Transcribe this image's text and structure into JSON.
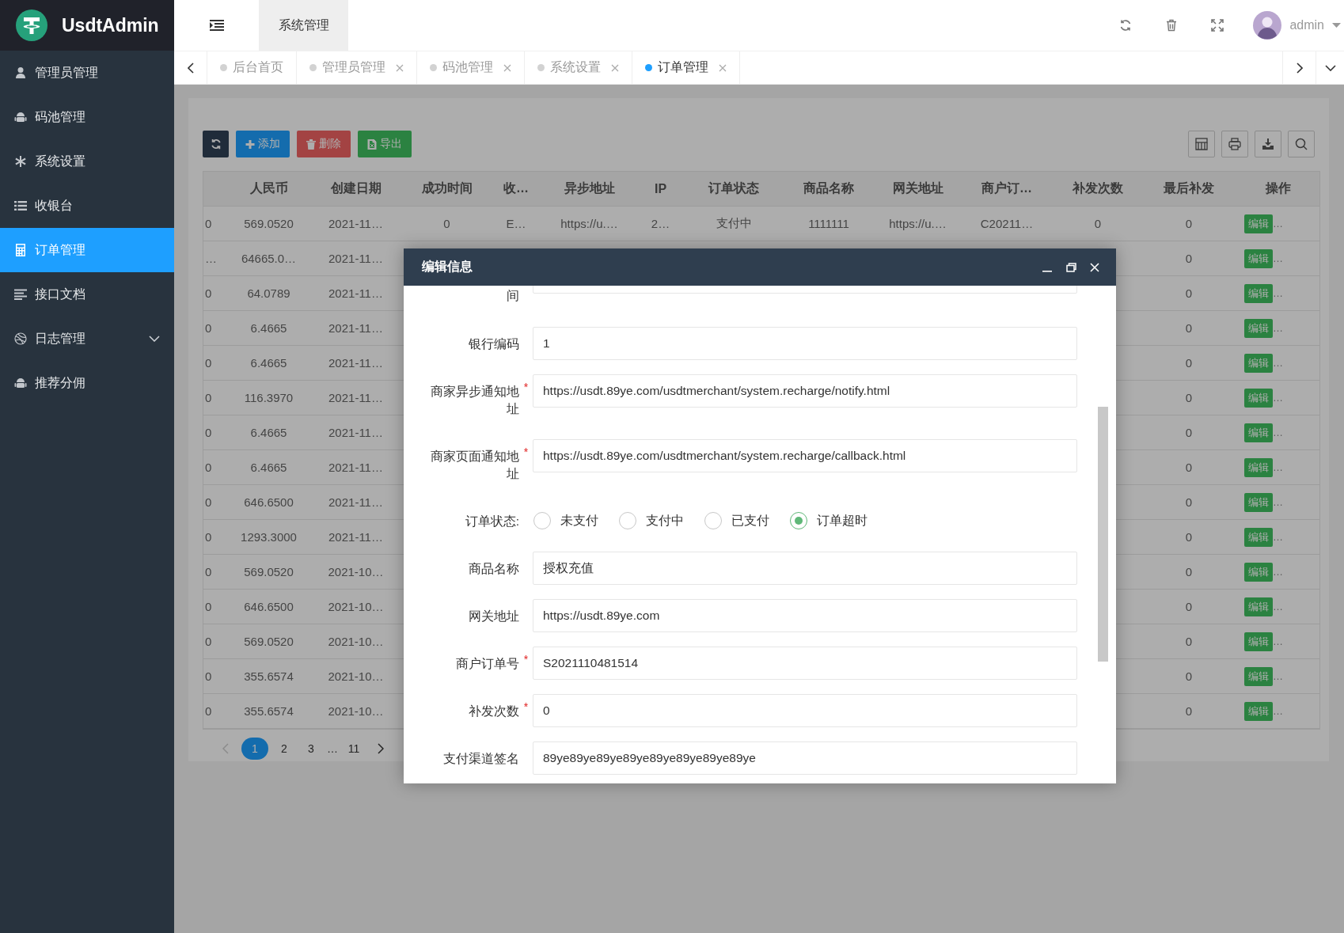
{
  "brand": {
    "name": "UsdtAdmin"
  },
  "header": {
    "nav_tab": "系统管理",
    "user": "admin"
  },
  "sidebar": {
    "items": [
      {
        "label": "管理员管理",
        "selected": false
      },
      {
        "label": "码池管理",
        "selected": false
      },
      {
        "label": "系统设置",
        "selected": false
      },
      {
        "label": "收银台",
        "selected": false
      },
      {
        "label": "订单管理",
        "selected": true
      },
      {
        "label": "接口文档",
        "selected": false
      },
      {
        "label": "日志管理",
        "selected": false,
        "expanded": false
      },
      {
        "label": "推荐分佣",
        "selected": false
      }
    ]
  },
  "tabs": [
    {
      "label": "后台首页",
      "selected": false,
      "closable": false
    },
    {
      "label": "管理员管理",
      "selected": false,
      "closable": true
    },
    {
      "label": "码池管理",
      "selected": false,
      "closable": true
    },
    {
      "label": "系统设置",
      "selected": false,
      "closable": true
    },
    {
      "label": "订单管理",
      "selected": true,
      "closable": true
    }
  ],
  "toolbar": {
    "buttons": [
      {
        "label": "添加",
        "kind": "add"
      },
      {
        "label": "删除",
        "kind": "delete"
      },
      {
        "label": "导出",
        "kind": "export"
      }
    ]
  },
  "table": {
    "columns": [
      null,
      "人民币",
      "创建日期",
      "成功时间",
      "收…",
      "异步地址",
      "IP",
      "订单状态",
      "商品名称",
      "网关地址",
      "商户订…",
      "补发次数",
      "最后补发",
      "操作"
    ],
    "rows": [
      {
        "cells": [
          "0",
          "569.0520",
          "2021-11…",
          "0",
          "E…",
          "https://u.…",
          "2…",
          "支付中",
          "1111111",
          "https://u.…",
          "C20211…",
          "0",
          "0"
        ],
        "action": "编辑",
        "more": "…"
      },
      {
        "cells": [
          "…",
          "64665.0…",
          "2021-11…",
          null,
          null,
          null,
          null,
          null,
          null,
          null,
          null,
          null,
          "0"
        ],
        "action": "编辑",
        "more": "…"
      },
      {
        "cells": [
          "0",
          "64.0789",
          "2021-11…",
          null,
          null,
          null,
          null,
          null,
          null,
          null,
          null,
          null,
          "0"
        ],
        "action": "编辑",
        "more": "…"
      },
      {
        "cells": [
          "0",
          "6.4665",
          "2021-11…",
          null,
          null,
          null,
          null,
          null,
          null,
          null,
          null,
          null,
          "0"
        ],
        "action": "编辑",
        "more": "…"
      },
      {
        "cells": [
          "0",
          "6.4665",
          "2021-11…",
          null,
          null,
          null,
          null,
          null,
          null,
          null,
          null,
          null,
          "0"
        ],
        "action": "编辑",
        "more": "…"
      },
      {
        "cells": [
          "0",
          "116.3970",
          "2021-11…",
          null,
          null,
          null,
          null,
          null,
          null,
          null,
          null,
          null,
          "0"
        ],
        "action": "编辑",
        "more": "…"
      },
      {
        "cells": [
          "0",
          "6.4665",
          "2021-11…",
          null,
          null,
          null,
          null,
          null,
          null,
          null,
          null,
          null,
          "0"
        ],
        "action": "编辑",
        "more": "…"
      },
      {
        "cells": [
          "0",
          "6.4665",
          "2021-11…",
          null,
          null,
          null,
          null,
          null,
          null,
          null,
          null,
          null,
          "0"
        ],
        "action": "编辑",
        "more": "…"
      },
      {
        "cells": [
          "0",
          "646.6500",
          "2021-11…",
          null,
          null,
          null,
          null,
          null,
          null,
          null,
          null,
          null,
          "0"
        ],
        "action": "编辑",
        "more": "…"
      },
      {
        "cells": [
          "0",
          "1293.3000",
          "2021-11…",
          null,
          null,
          null,
          null,
          null,
          null,
          null,
          null,
          null,
          "0"
        ],
        "action": "编辑",
        "more": "…"
      },
      {
        "cells": [
          "0",
          "569.0520",
          "2021-10…",
          null,
          null,
          null,
          null,
          null,
          null,
          null,
          null,
          null,
          "0"
        ],
        "action": "编辑",
        "more": "…"
      },
      {
        "cells": [
          "0",
          "646.6500",
          "2021-10…",
          null,
          null,
          null,
          null,
          null,
          null,
          null,
          null,
          null,
          "0"
        ],
        "action": "编辑",
        "more": "…"
      },
      {
        "cells": [
          "0",
          "569.0520",
          "2021-10…",
          null,
          null,
          null,
          null,
          null,
          null,
          null,
          null,
          null,
          "0"
        ],
        "action": "编辑",
        "more": "…"
      },
      {
        "cells": [
          "0",
          "355.6574",
          "2021-10…",
          null,
          null,
          null,
          null,
          null,
          null,
          null,
          null,
          null,
          "0"
        ],
        "action": "编辑",
        "more": "…"
      },
      {
        "cells": [
          "0",
          "355.6574",
          "2021-10…",
          null,
          null,
          null,
          null,
          null,
          null,
          null,
          null,
          null,
          "0"
        ],
        "action": "编辑",
        "more": "…"
      }
    ]
  },
  "pagination": {
    "prev_disabled": true,
    "pages": [
      {
        "label": "1",
        "kind": "page",
        "selected": true
      },
      {
        "label": "2",
        "kind": "page",
        "selected": false
      },
      {
        "label": "3",
        "kind": "page",
        "selected": false
      },
      {
        "label": "…",
        "kind": "gap"
      },
      {
        "label": "11",
        "kind": "page",
        "selected": false
      }
    ]
  },
  "dialog": {
    "title": "编辑信息",
    "fields": [
      {
        "kind": "partial_input",
        "label": "间"
      },
      {
        "kind": "input",
        "label": "银行编码",
        "value": "1"
      },
      {
        "kind": "input",
        "label": "商家异步通知地址",
        "value": "https://usdt.89ye.com/usdtmerchant/system.recharge/notify.html",
        "required_mark": "*"
      },
      {
        "kind": "input",
        "label": "商家页面通知地址",
        "value": "https://usdt.89ye.com/usdtmerchant/system.recharge/callback.html",
        "required_mark": "*"
      },
      {
        "kind": "radio",
        "label": "订单状态:",
        "options": [
          {
            "label": "未支付",
            "selected": false
          },
          {
            "label": "支付中",
            "selected": false
          },
          {
            "label": "已支付",
            "selected": false
          },
          {
            "label": "订单超时",
            "selected": true
          }
        ]
      },
      {
        "kind": "input",
        "label": "商品名称",
        "value": "授权充值"
      },
      {
        "kind": "input",
        "label": "网关地址",
        "value": "https://usdt.89ye.com"
      },
      {
        "kind": "input",
        "label": "商户订单号",
        "value": "S2021110481514",
        "required_mark": "*"
      },
      {
        "kind": "input",
        "label": "补发次数",
        "value": "0",
        "required_mark": "*"
      },
      {
        "kind": "input",
        "label": "支付渠道签名",
        "value": "89ye89ye89ye89ye89ye89ye89ye89ye"
      }
    ]
  }
}
